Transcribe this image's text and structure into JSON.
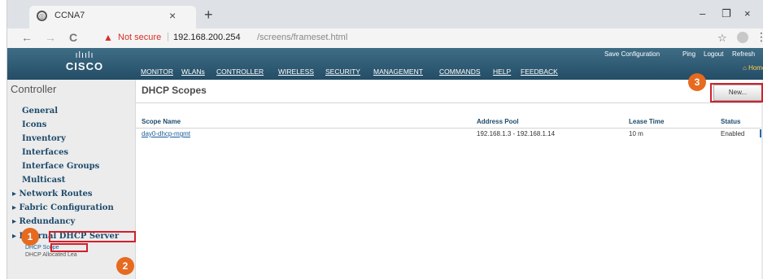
{
  "browser": {
    "tab_title": "CCNA7",
    "tab_close": "×",
    "new_tab": "+",
    "minimize": "–",
    "restore": "❐",
    "close": "×",
    "back": "←",
    "forward": "→",
    "reload": "C",
    "not_secure": "Not secure",
    "url_host": "192.168.200.254",
    "url_path": "/screens/frameset.html",
    "star": "☆",
    "kebab": "⋮"
  },
  "cisco": {
    "logo_bars": "ılıılı",
    "logo_word": "CISCO",
    "menu": [
      "MONITOR",
      "WLANs",
      "CONTROLLER",
      "WIRELESS",
      "SECURITY",
      "MANAGEMENT",
      "COMMANDS",
      "HELP",
      "FEEDBACK"
    ],
    "top_links": [
      "Save Configuration",
      "Ping",
      "Logout",
      "Refresh"
    ],
    "home": "Home"
  },
  "sidebar": {
    "heading": "Controller",
    "items": [
      "General",
      "Icons",
      "Inventory",
      "Interfaces",
      "Interface Groups",
      "Multicast",
      "Network Routes",
      "Fabric Configuration",
      "Redundancy",
      "Internal DHCP Server"
    ],
    "expand_marker": "▸",
    "sub_items": [
      "DHCP Scope",
      "DHCP Allocated Lea"
    ]
  },
  "main": {
    "title": "DHCP Scopes",
    "new_button": "New...",
    "columns": [
      "Scope Name",
      "Address Pool",
      "Lease Time",
      "Status"
    ],
    "rows": [
      {
        "scope_name": "day0-dhcp-mgmt",
        "address_pool": "192.168.1.3 - 192.168.1.14",
        "lease_time": "10 m",
        "status": "Enabled"
      }
    ]
  },
  "annotations": {
    "markers": [
      "1",
      "2",
      "3"
    ],
    "marker_color": "#e66a20",
    "box_color": "#d1202c"
  }
}
